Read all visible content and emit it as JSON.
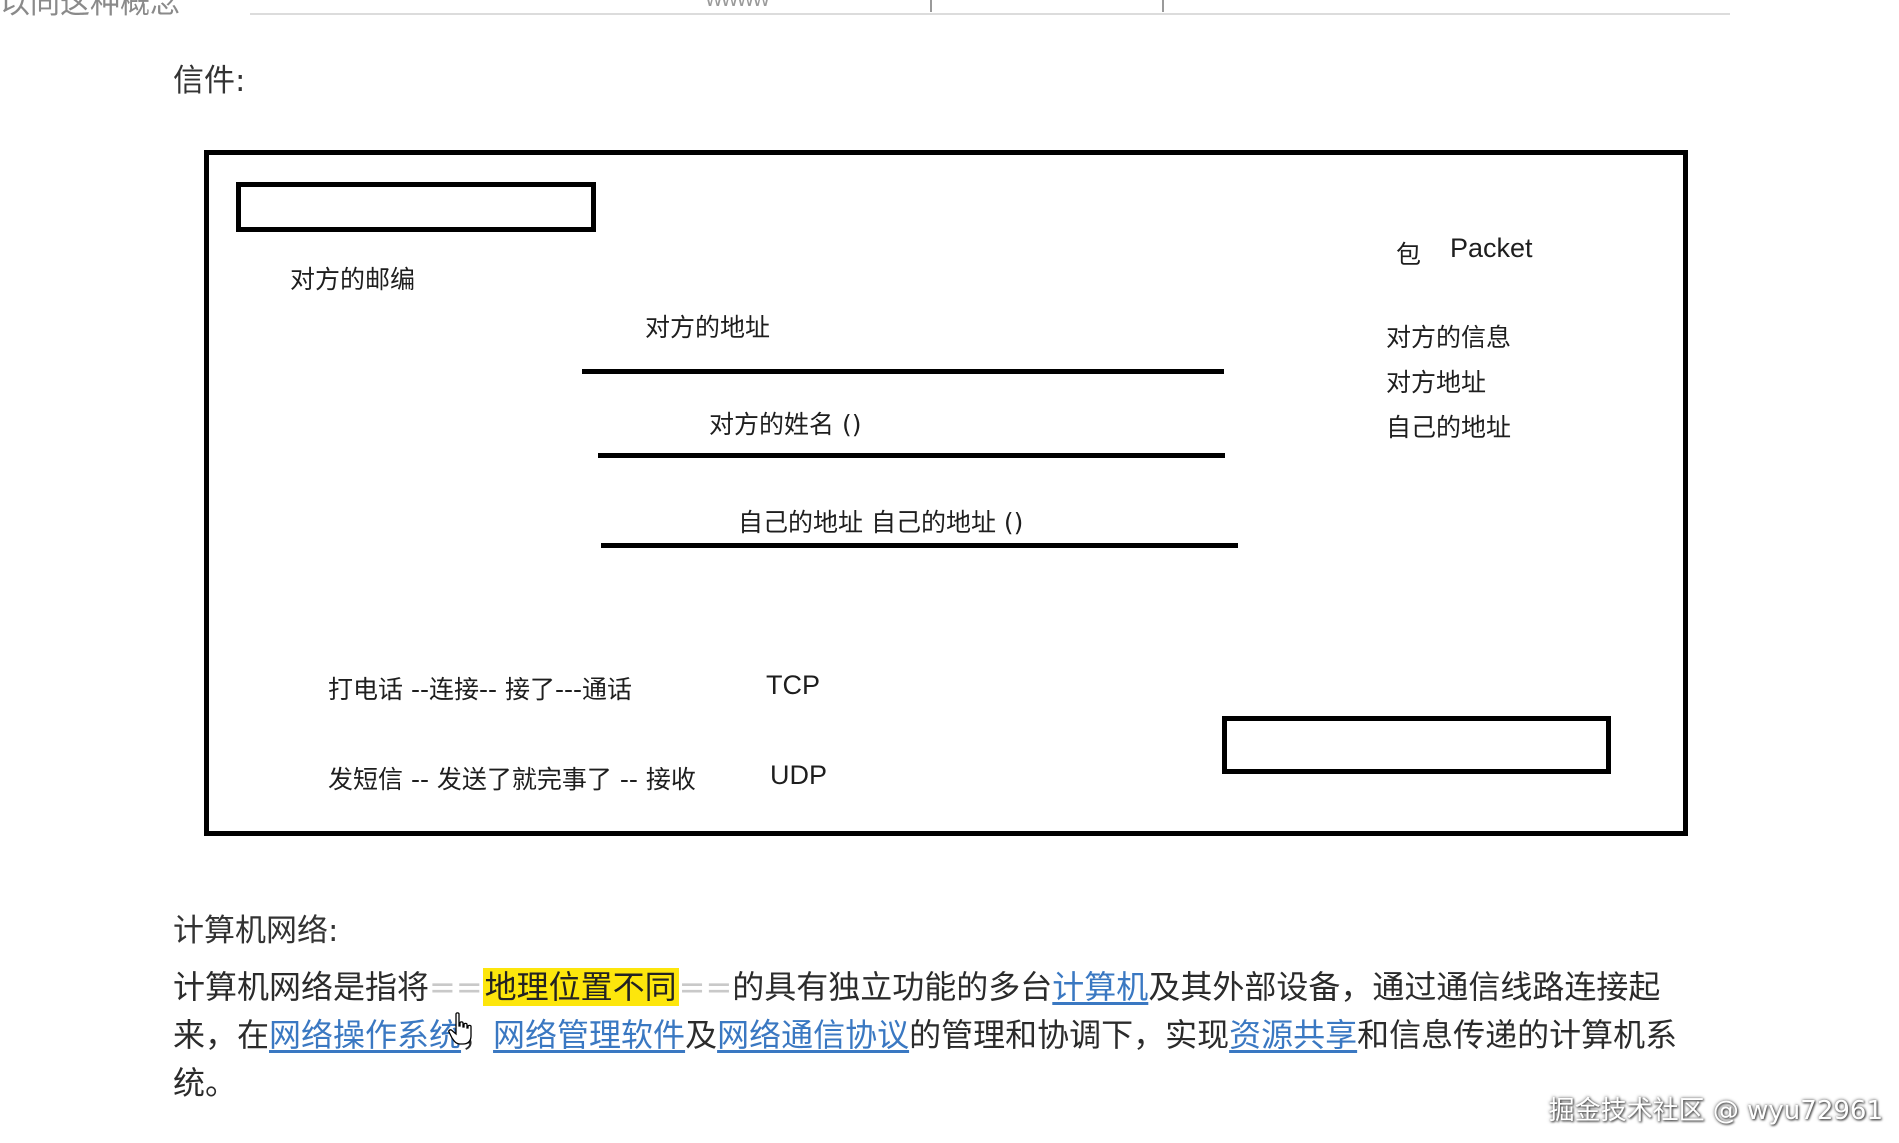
{
  "top_cut_text": "以同这种概念",
  "top_marks_text": "WWWW",
  "section_letter_title": "信件:",
  "diagram": {
    "postcode_label": "对方的邮编",
    "address_label": "对方的地址",
    "name_label": "对方的姓名  ()",
    "own_address_label": "自己的地址  自己的地址  ()",
    "packet_cn": "包",
    "packet_en": "Packet",
    "info_items": [
      "对方的信息",
      "对方地址",
      "自己的地址"
    ],
    "tcp_line": "打电话   --连接--  接了---通话",
    "tcp_label": "TCP",
    "udp_line": "发短信  -- 发送了就完事了 -- 接收",
    "udp_label": "UDP"
  },
  "section_network_title": "计算机网络:",
  "paragraph": {
    "p1": "计算机网络是指将",
    "eq1": "==",
    "highlight": "地理位置不同",
    "eq2": "==",
    "p2": "的具有独立功能的多台",
    "link_computer": "计算机",
    "p3": "及其外部设备，通过通信线路连接起来，在",
    "link_os": "网络操作系统",
    "p4": "，",
    "link_mgmt": "网络管理软件",
    "p5": "及",
    "link_protocol": "网络通信协议",
    "p6": "的管理和协调下，实现",
    "link_share": "资源共享",
    "p7": "和信息传递的计算机系统。"
  },
  "watermark": "掘金技术社区 @ wyu72961",
  "colors": {
    "link": "#3a78c2",
    "highlight": "#fde60c"
  }
}
